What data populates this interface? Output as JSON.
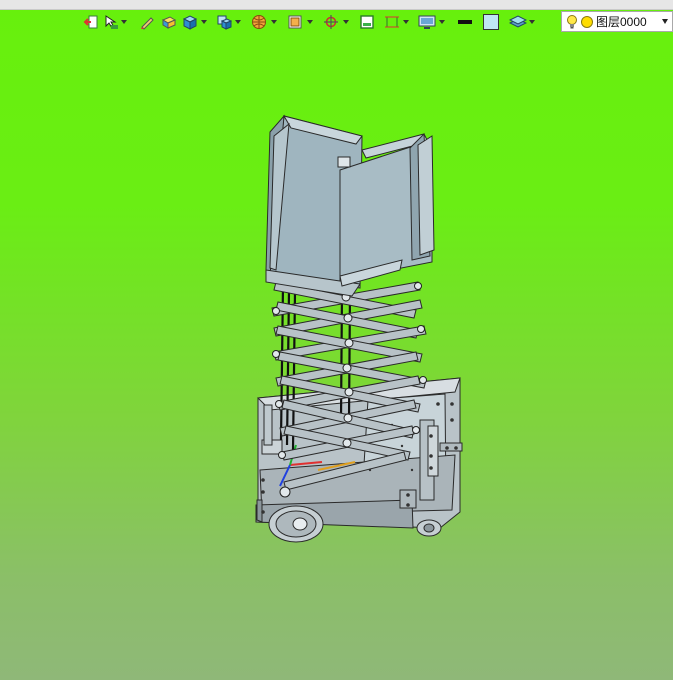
{
  "toolbar": {
    "tools": [
      {
        "icon": "exit-arrow-icon",
        "dropdown": false
      },
      {
        "icon": "cursor-select-icon",
        "dropdown": true
      },
      {
        "icon": "pencil-icon",
        "dropdown": false
      },
      {
        "icon": "yellow-box-icon",
        "dropdown": false
      },
      {
        "icon": "blue-cube-icon",
        "dropdown": true
      },
      {
        "icon": "stack-cube-icon",
        "dropdown": true
      },
      {
        "icon": "sphere-grid-icon",
        "dropdown": true
      },
      {
        "icon": "render-view-icon",
        "dropdown": true
      },
      {
        "icon": "crosshair-target-icon",
        "dropdown": true
      },
      {
        "icon": "green-window-icon",
        "dropdown": false
      },
      {
        "icon": "dimension-frame-icon",
        "dropdown": true
      },
      {
        "icon": "monitor-display-icon",
        "dropdown": true
      },
      {
        "icon": "line-weight-icon",
        "dropdown": false
      },
      {
        "icon": "fill-color-icon",
        "dropdown": false
      },
      {
        "icon": "layers-plane-icon",
        "dropdown": true
      }
    ]
  },
  "layer": {
    "current": "图层0000",
    "bulb_color": "#ffe84a",
    "circle_color": "#ffdd00"
  },
  "viewport": {
    "background_top": "#67f00c",
    "background_bottom": "#8fb878",
    "model": "scissor-lift-cart"
  }
}
